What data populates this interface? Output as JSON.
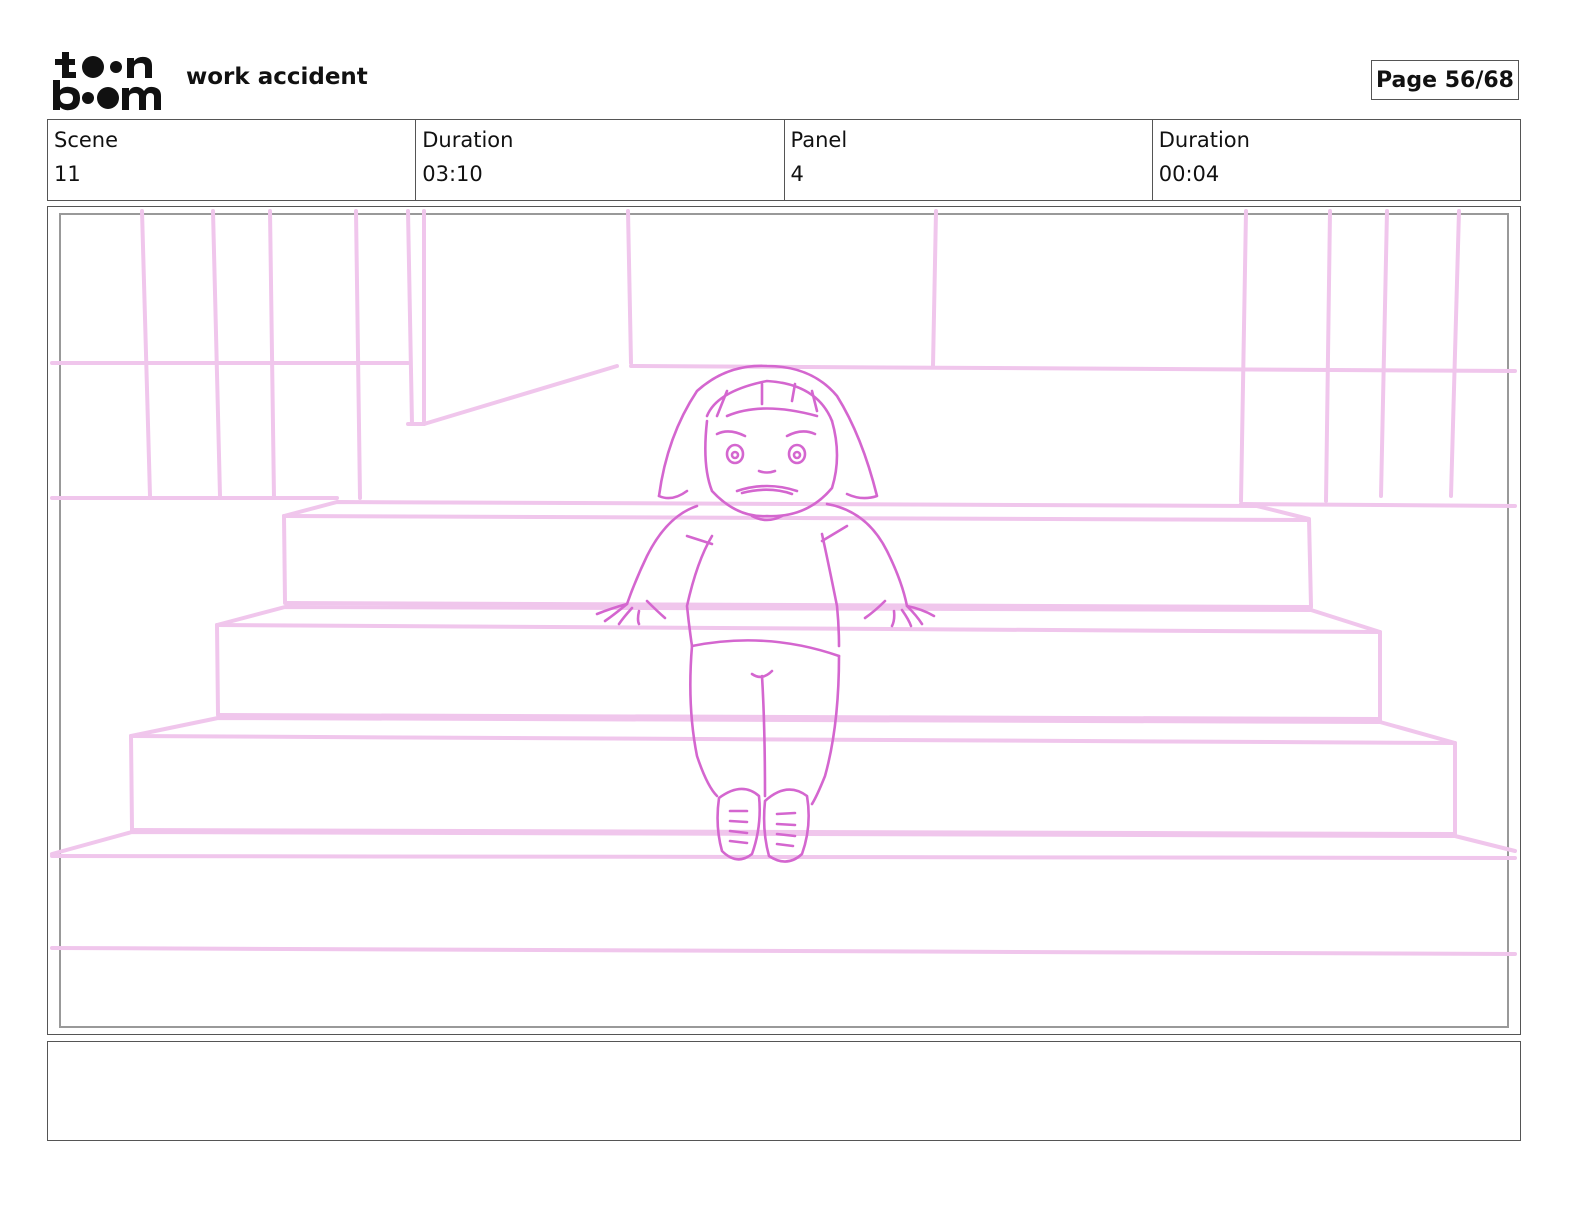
{
  "header": {
    "logo_text": "toon boom",
    "title": "work accident",
    "page_label": "Page 56/68"
  },
  "info": [
    {
      "label": "Scene",
      "value": "11"
    },
    {
      "label": "Duration",
      "value": "03:10"
    },
    {
      "label": "Panel",
      "value": "4"
    },
    {
      "label": "Duration",
      "value": "00:04"
    }
  ],
  "colors": {
    "background_sketch": "#f0c6ec",
    "character_sketch": "#d466cf",
    "frame": "#555555"
  },
  "notes": {
    "text": ""
  }
}
